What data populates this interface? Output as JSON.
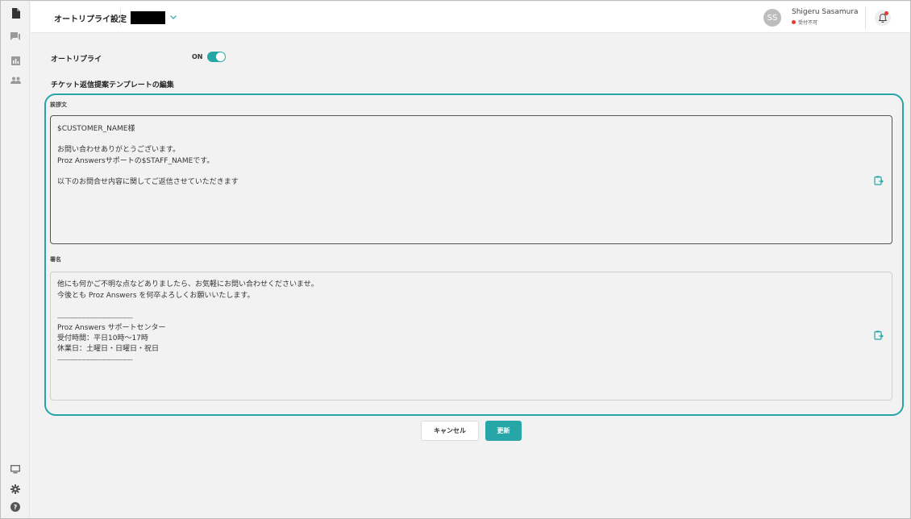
{
  "header": {
    "title": "オートリプライ設定",
    "user_initials": "SS",
    "user_name": "Shigeru Sasamura",
    "user_status": "受付不可"
  },
  "auto_reply": {
    "label": "オートリプライ",
    "toggle_text": "ON",
    "enabled": true
  },
  "section_title": "チケット返信提案テンプレートの編集",
  "greeting": {
    "label": "挨拶文",
    "lines": [
      "$CUSTOMER_NAME様",
      "",
      "お問い合わせありがとうございます。",
      "Proz Answersサポートの$STAFF_NAMEです。",
      "",
      "以下のお問合せ内容に関してご返信させていただきます"
    ]
  },
  "signature": {
    "label": "署名",
    "lines": [
      "他にも何かご不明な点などありましたら、お気軽にお問い合わせくださいませ。",
      "今後とも Proz Answers を何卒よろしくお願いいたします。",
      "",
      "--------------------------------------------------------",
      "Proz Answers サポートセンター",
      "受付時間：平日10時〜17時",
      "休業日：土曜日・日曜日・祝日",
      "--------------------------------------------------------"
    ]
  },
  "buttons": {
    "cancel": "キャンセル",
    "update": "更新"
  },
  "colors": {
    "accent": "#26a6a6",
    "status_unavailable": "#e53935"
  },
  "icons": {
    "sidebar_top": [
      "document-icon",
      "chat-icon",
      "chart-icon",
      "users-icon"
    ],
    "sidebar_bottom": [
      "monitor-icon",
      "gear-icon",
      "help-icon"
    ]
  }
}
